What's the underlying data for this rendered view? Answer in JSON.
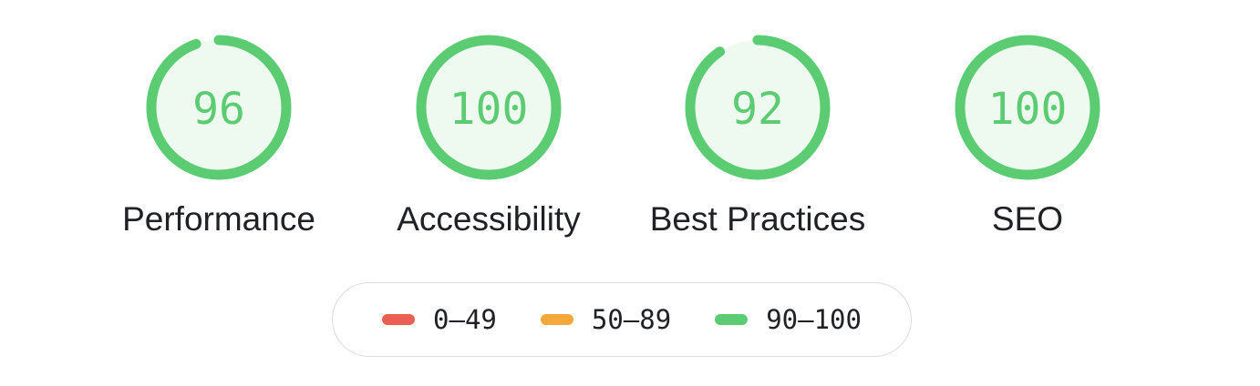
{
  "colors": {
    "pass": "#5ccc72",
    "pass_fill": "#eef9f0",
    "pass_text": "#5ccc72",
    "average": "#f4a73a",
    "fail": "#ec5f53"
  },
  "gauges": [
    {
      "label": "Performance",
      "score": "96",
      "value": 96,
      "rating": "pass"
    },
    {
      "label": "Accessibility",
      "score": "100",
      "value": 100,
      "rating": "pass"
    },
    {
      "label": "Best Practices",
      "score": "92",
      "value": 92,
      "rating": "pass"
    },
    {
      "label": "SEO",
      "score": "100",
      "value": 100,
      "rating": "pass"
    }
  ],
  "legend": [
    {
      "range": "0–49",
      "rating": "fail"
    },
    {
      "range": "50–89",
      "rating": "average"
    },
    {
      "range": "90–100",
      "rating": "pass"
    }
  ]
}
